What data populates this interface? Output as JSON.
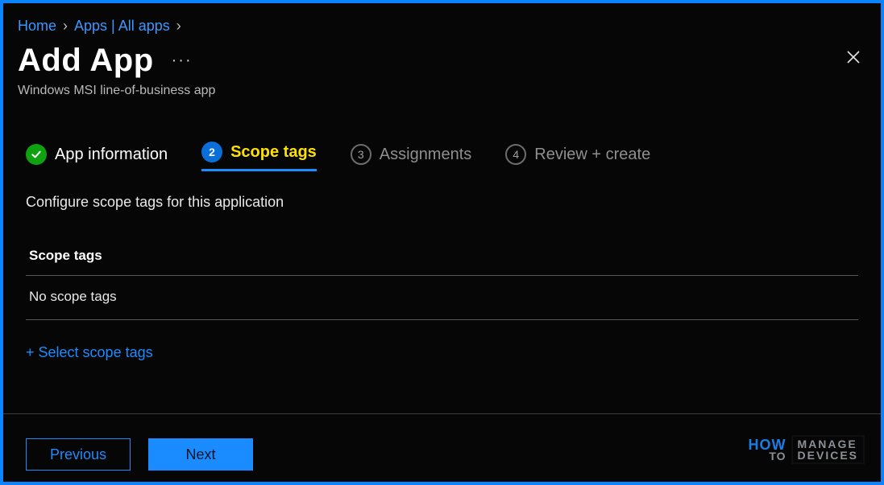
{
  "breadcrumb": {
    "home": "Home",
    "apps": "Apps | All apps"
  },
  "header": {
    "title": "Add App",
    "more": "···",
    "subtitle": "Windows MSI line-of-business app"
  },
  "stepper": {
    "step1_label": "App information",
    "step2_num": "2",
    "step2_label": "Scope tags",
    "step3_num": "3",
    "step3_label": "Assignments",
    "step4_num": "4",
    "step4_label": "Review + create"
  },
  "body": {
    "description": "Configure scope tags for this application",
    "section_header": "Scope tags",
    "empty_row": "No scope tags",
    "select_link": "+ Select scope tags"
  },
  "footer": {
    "previous": "Previous",
    "next": "Next"
  },
  "watermark": {
    "how": "HOW",
    "to": "TO",
    "manage": "MANAGE",
    "devices": "DEVICES"
  }
}
